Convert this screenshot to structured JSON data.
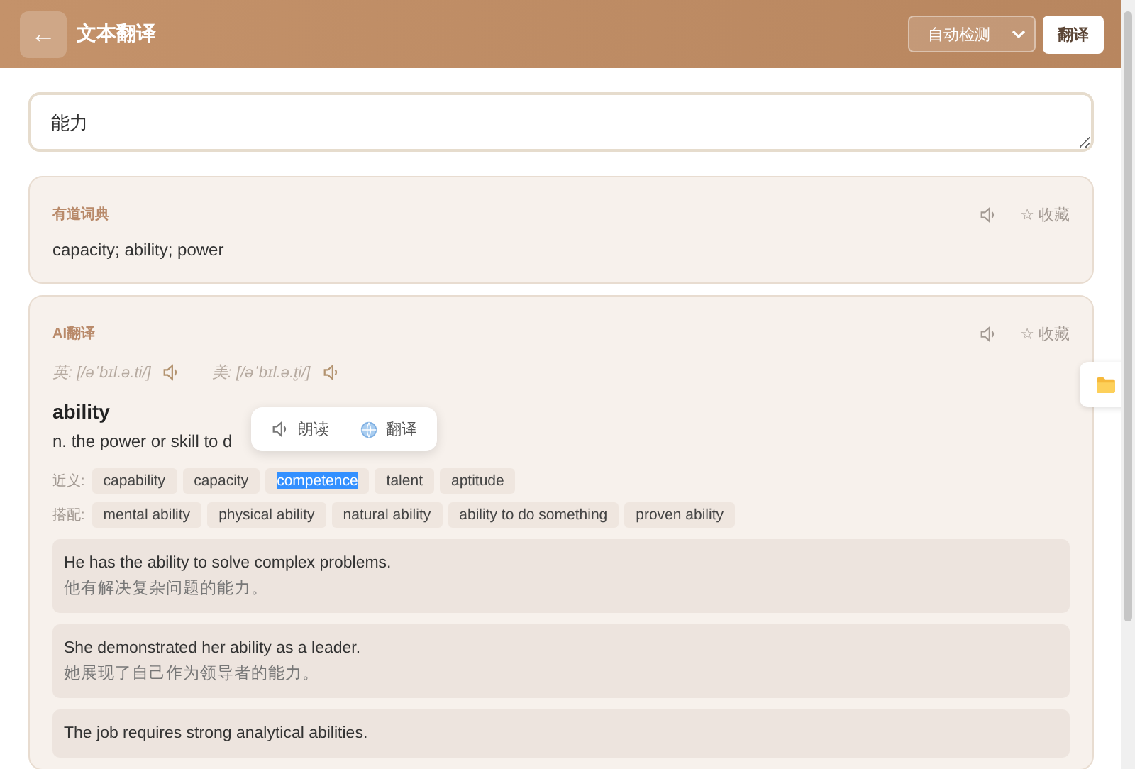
{
  "header": {
    "back_icon": "←",
    "title": "文本翻译",
    "language_select": "自动检测",
    "translate_button": "翻译"
  },
  "input": {
    "value": "能力"
  },
  "dictionary_card": {
    "title": "有道词典",
    "favorite": "☆ 收藏",
    "text": "capacity; ability; power"
  },
  "ai_card": {
    "title": "AI翻译",
    "favorite": "☆ 收藏",
    "phonetics": [
      {
        "label": "英: [/əˈbɪl.ə.ti/]"
      },
      {
        "label": "美: [/əˈbɪl.ə.t̬i/]"
      }
    ],
    "word": "ability",
    "definition": "n. the power or skill to d",
    "popup": {
      "read": "朗读",
      "translate": "翻译"
    },
    "synonyms_label": "近义:",
    "synonyms": [
      {
        "text": "capability",
        "selected": false
      },
      {
        "text": "capacity",
        "selected": false
      },
      {
        "text": "competence",
        "selected": true
      },
      {
        "text": "talent",
        "selected": false
      },
      {
        "text": "aptitude",
        "selected": false
      }
    ],
    "collocations_label": "搭配:",
    "collocations": [
      "mental ability",
      "physical ability",
      "natural ability",
      "ability to do something",
      "proven ability"
    ],
    "examples": [
      {
        "en": "He has the ability to solve complex problems.",
        "zh": "他有解决复杂问题的能力。"
      },
      {
        "en": "She demonstrated her ability as a leader.",
        "zh": "她展现了自己作为领导者的能力。"
      },
      {
        "en": "The job requires strong analytical abilities."
      }
    ]
  }
}
